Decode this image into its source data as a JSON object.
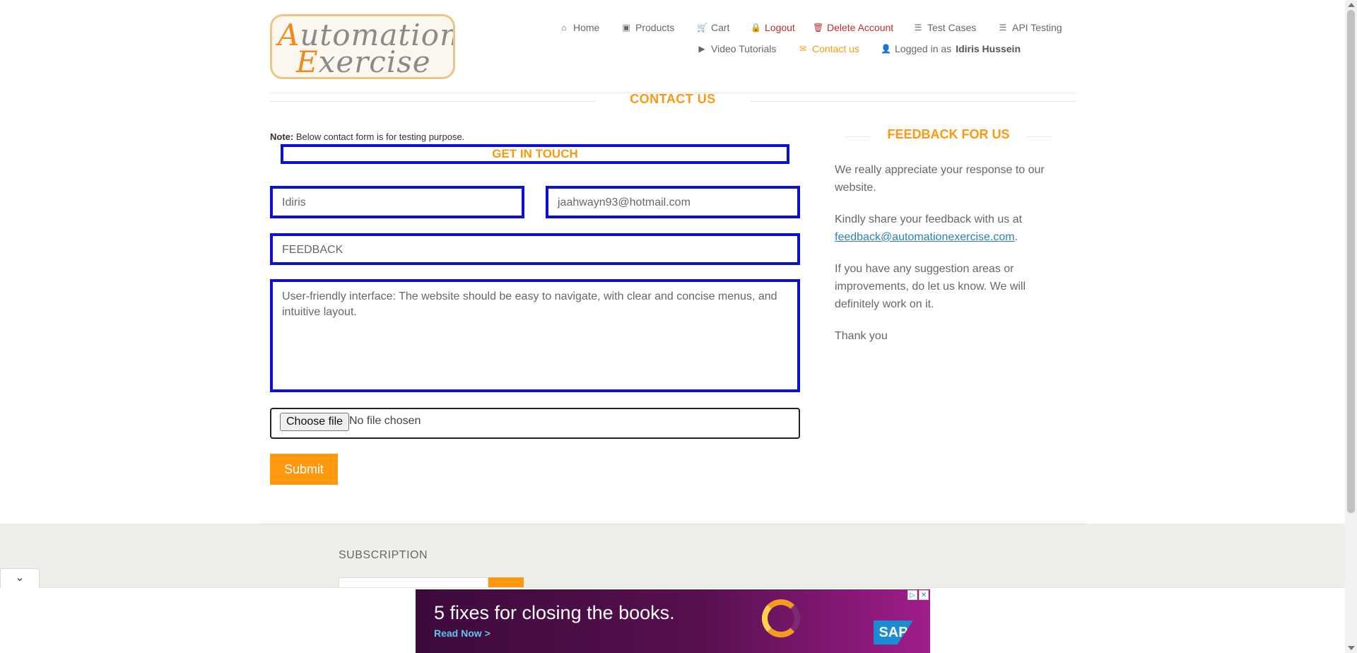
{
  "logo": {
    "line1_cap": "A",
    "line1_rest": "utomation",
    "line2_cap": "E",
    "line2_rest": "xercise"
  },
  "nav": {
    "home": {
      "icon": "home-icon",
      "label": "Home"
    },
    "products": {
      "icon": "products-icon",
      "label": "Products"
    },
    "cart": {
      "icon": "cart-icon",
      "label": "Cart"
    },
    "logout": {
      "icon": "lock-icon",
      "label": "Logout"
    },
    "delete_account": {
      "icon": "trash-icon",
      "label": "Delete Account"
    },
    "test_cases": {
      "icon": "list-icon",
      "label": "Test Cases"
    },
    "api_testing": {
      "icon": "list-icon",
      "label": "API Testing"
    },
    "video_tutorials": {
      "icon": "youtube-icon",
      "label": "Video Tutorials"
    },
    "contact_us": {
      "icon": "envelope-icon",
      "label": "Contact us"
    },
    "logged_in_prefix": "Logged in as",
    "logged_in_user": "Idiris Hussein"
  },
  "contact": {
    "title": "CONTACT US",
    "note_label": "Note:",
    "note_text": "Below contact form is for testing purpose.",
    "get_in_touch": "GET IN TOUCH",
    "name_value": "Idiris",
    "email_value": "jaahwayn93@hotmail.com",
    "subject_value": "FEEDBACK",
    "message_value": "User-friendly interface: The website should be easy to navigate, with clear and concise menus, and intuitive layout.",
    "file_button": "Choose file",
    "file_status": "No file chosen",
    "submit_label": "Submit"
  },
  "feedback": {
    "title": "FEEDBACK FOR US",
    "p1": "We really appreciate your response to our website.",
    "p2_prefix": "Kindly share your feedback with us at",
    "p2_email": "feedback@automationexercise.com",
    "p2_suffix": ".",
    "p3": "If you have any suggestion areas or improvements, do let us know. We will definitely work on it.",
    "p4": "Thank you"
  },
  "footer": {
    "subscription_title": "SUBSCRIPTION"
  },
  "ad": {
    "headline": "5 fixes for closing the books.",
    "cta": "Read Now >",
    "brand": "SAP"
  },
  "colors": {
    "accent": "#fe980f",
    "highlight_border": "#0b10d6",
    "danger": "#b93131"
  }
}
